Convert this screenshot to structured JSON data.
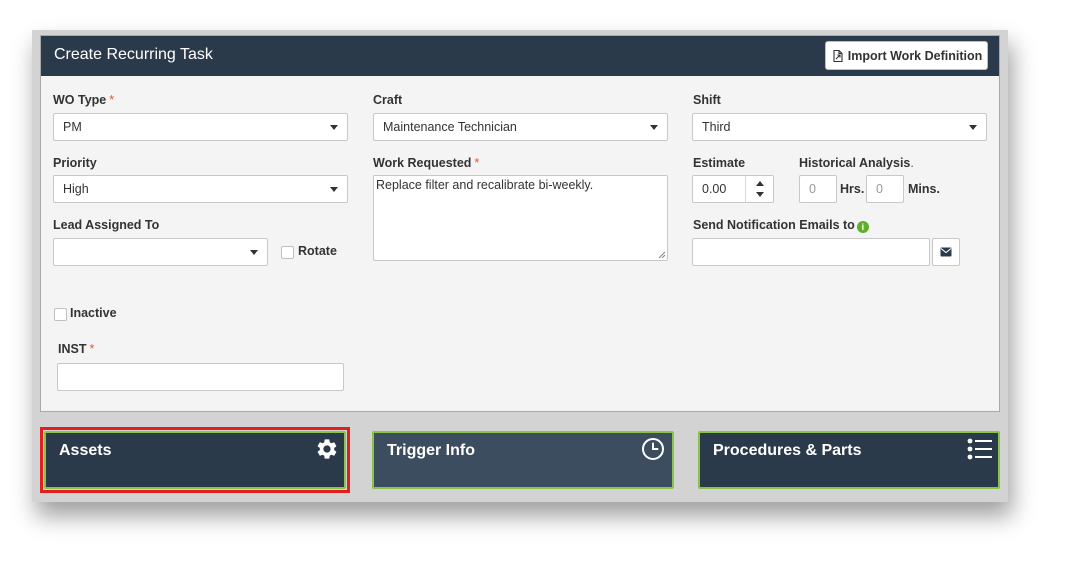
{
  "header": {
    "title": "Create Recurring Task",
    "import_button": "Import Work Definition"
  },
  "form": {
    "wo_type": {
      "label": "WO Type",
      "required_mark": "*",
      "value": "PM"
    },
    "craft": {
      "label": "Craft",
      "value": "Maintenance Technician"
    },
    "shift": {
      "label": "Shift",
      "value": "Third"
    },
    "priority": {
      "label": "Priority",
      "value": "High"
    },
    "work_requested": {
      "label": "Work Requested",
      "required_mark": "*",
      "value": "Replace filter and recalibrate bi-weekly."
    },
    "estimate": {
      "label": "Estimate",
      "value": "0.00"
    },
    "historical_analysis": {
      "label": "Historical Analysis",
      "suffix": ".",
      "hours_value": "0",
      "hours_label": "Hrs.",
      "mins_value": "0",
      "mins_label": "Mins."
    },
    "lead_assigned": {
      "label": "Lead Assigned To",
      "value": ""
    },
    "rotate": {
      "label": "Rotate",
      "checked": false
    },
    "notification": {
      "label": "Send Notification Emails to",
      "info_glyph": "i",
      "value": ""
    },
    "inactive": {
      "label": "Inactive",
      "checked": false
    },
    "inst": {
      "label": "INST",
      "required_mark": "*",
      "value": ""
    }
  },
  "tiles": [
    {
      "label": "Assets",
      "icon": "gear-icon",
      "highlighted": true
    },
    {
      "label": "Trigger Info",
      "icon": "clock-icon",
      "highlighted": false
    },
    {
      "label": "Procedures & Parts",
      "icon": "list-icon",
      "highlighted": false
    }
  ],
  "colors": {
    "header_bg": "#2b3a4b",
    "tile_border": "#8bc34a",
    "required": "#e05a2b",
    "highlight": "#e02020",
    "info": "#5fae2e"
  }
}
